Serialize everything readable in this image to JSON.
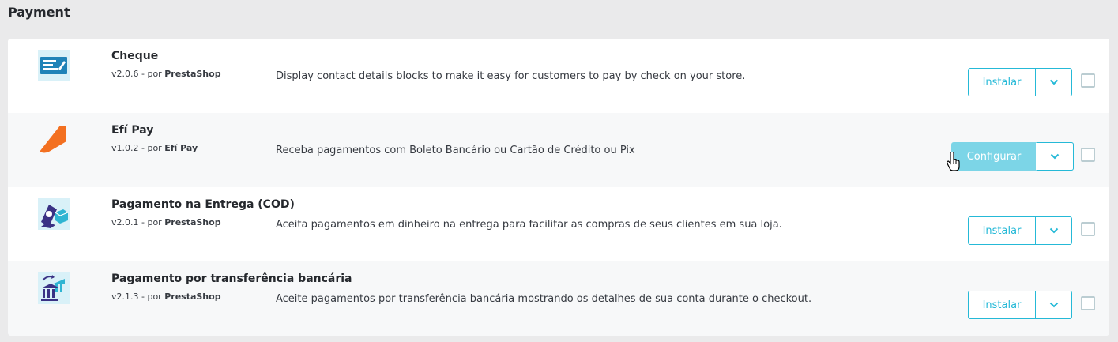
{
  "section": {
    "title": "Payment"
  },
  "modules": [
    {
      "name": "Cheque",
      "version_prefix": "v2.0.6 - por ",
      "author": "PrestaShop",
      "description": "Display contact details blocks to make it easy for customers to pay by check on your store.",
      "action_label": "Instalar",
      "icon": "cheque-icon"
    },
    {
      "name": "Efí Pay",
      "version_prefix": "v1.0.2 - por ",
      "author": "Efí Pay",
      "description": "Receba pagamentos com Boleto Bancário ou Cartão de Crédito ou Pix",
      "action_label": "Configurar",
      "icon": "efi-pay-logo-icon"
    },
    {
      "name": "Pagamento na Entrega (COD)",
      "version_prefix": "v2.0.1 - por ",
      "author": "PrestaShop",
      "description": "Aceita pagamentos em dinheiro na entrega para facilitar as compras de seus clientes em sua loja.",
      "action_label": "Instalar",
      "icon": "cash-on-delivery-icon"
    },
    {
      "name": "Pagamento por transferência bancária",
      "version_prefix": "v2.1.3 - por ",
      "author": "PrestaShop",
      "description": "Aceite pagamentos por transferência bancária mostrando os detalhes de sua conta durante o checkout.",
      "action_label": "Instalar",
      "icon": "bank-transfer-icon"
    }
  ],
  "colors": {
    "accent": "#25b9d7",
    "accent_hover": "#7cd5e7",
    "efi_orange": "#f37021"
  }
}
